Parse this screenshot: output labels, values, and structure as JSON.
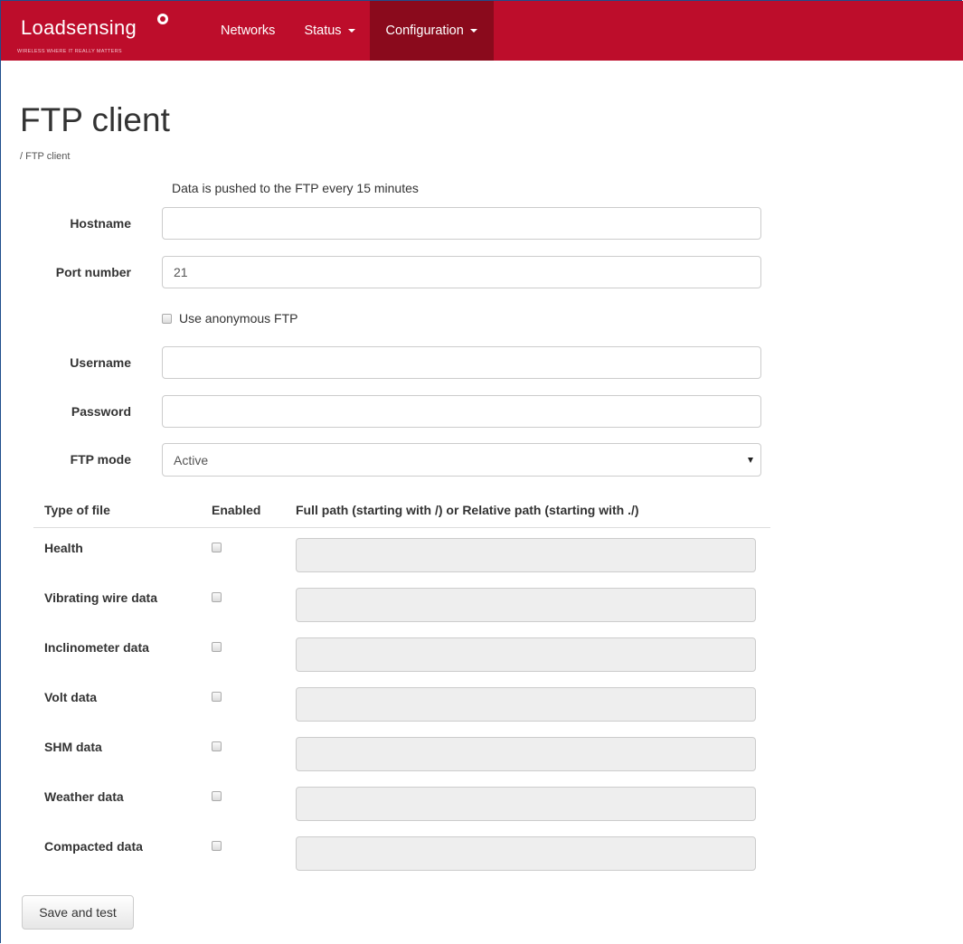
{
  "navbar": {
    "brand": "Loadsensing",
    "tagline": "WIRELESS WHERE IT REALLY MATTERS",
    "items": [
      {
        "label": "Networks",
        "dropdown": false,
        "active": false
      },
      {
        "label": "Status",
        "dropdown": true,
        "active": false
      },
      {
        "label": "Configuration",
        "dropdown": true,
        "active": true
      }
    ],
    "color": "#bd0d2b",
    "active_color": "#8a0a1c"
  },
  "page": {
    "title": "FTP client",
    "breadcrumb": "/ FTP client",
    "notice": "Data is pushed to the FTP every 15 minutes"
  },
  "form": {
    "hostname_label": "Hostname",
    "hostname_value": "",
    "port_label": "Port number",
    "port_value": "21",
    "anonymous_label": "Use anonymous FTP",
    "username_label": "Username",
    "username_value": "",
    "password_label": "Password",
    "password_value": "",
    "mode_label": "FTP mode",
    "mode_value": "Active"
  },
  "table": {
    "headers": [
      "Type of file",
      "Enabled",
      "Full path (starting with /) or Relative path (starting with ./)"
    ],
    "rows": [
      {
        "type": "Health",
        "enabled": false,
        "path": ""
      },
      {
        "type": "Vibrating wire data",
        "enabled": false,
        "path": ""
      },
      {
        "type": "Inclinometer data",
        "enabled": false,
        "path": ""
      },
      {
        "type": "Volt data",
        "enabled": false,
        "path": ""
      },
      {
        "type": "SHM data",
        "enabled": false,
        "path": ""
      },
      {
        "type": "Weather data",
        "enabled": false,
        "path": ""
      },
      {
        "type": "Compacted data",
        "enabled": false,
        "path": ""
      }
    ]
  },
  "actions": {
    "save_label": "Save and test"
  }
}
